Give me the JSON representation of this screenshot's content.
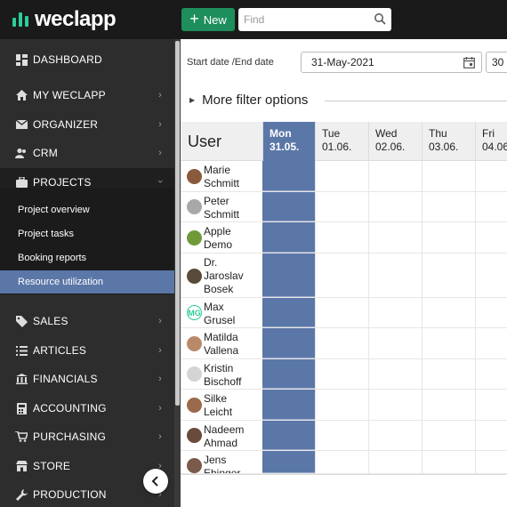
{
  "topbar": {
    "logo_text": "weclapp",
    "new_label": "New",
    "search_placeholder": "Find"
  },
  "sidebar": {
    "dashboard": "DASHBOARD",
    "my_weclapp": "MY WECLAPP",
    "organizer": "ORGANIZER",
    "crm": "CRM",
    "projects": "PROJECTS",
    "sub": [
      "Project overview",
      "Project tasks",
      "Booking reports",
      "Resource utilization"
    ],
    "sales": "SALES",
    "articles": "ARTICLES",
    "financials": "FINANCIALS",
    "accounting": "ACCOUNTING",
    "purchasing": "PURCHASING",
    "store": "STORE",
    "production": "PRODUCTION"
  },
  "filters": {
    "date_label": "Start date /End date",
    "start_date": "31-May-2021",
    "end_date": "30",
    "more_filter": "More filter options"
  },
  "grid": {
    "user_header": "User",
    "days": [
      {
        "d": "Mon",
        "date": "31.05."
      },
      {
        "d": "Tue",
        "date": "01.06."
      },
      {
        "d": "Wed",
        "date": "02.06."
      },
      {
        "d": "Thu",
        "date": "03.06."
      },
      {
        "d": "Fri",
        "date": "04.06"
      }
    ],
    "users": [
      {
        "l1": "Marie",
        "l2": "Schmitt"
      },
      {
        "l1": "Peter",
        "l2": "Schmitt"
      },
      {
        "l1": "Apple",
        "l2": "Demo"
      },
      {
        "l1": "Dr.",
        "l2": "Jaroslav",
        "l3": "Bosek"
      },
      {
        "l1": "Max",
        "l2": "Grusel"
      },
      {
        "l1": "Matilda",
        "l2": "Vallena"
      },
      {
        "l1": "Kristin",
        "l2": "Bischoff"
      },
      {
        "l1": "Silke",
        "l2": "Leicht"
      },
      {
        "l1": "Nadeem",
        "l2": "Ahmad"
      },
      {
        "l1": "Jens",
        "l2": "Ehinger"
      }
    ]
  },
  "colors": {
    "accent": "#1e8f5c",
    "today": "#5b77a8",
    "sidebar": "#2d2d2d"
  }
}
